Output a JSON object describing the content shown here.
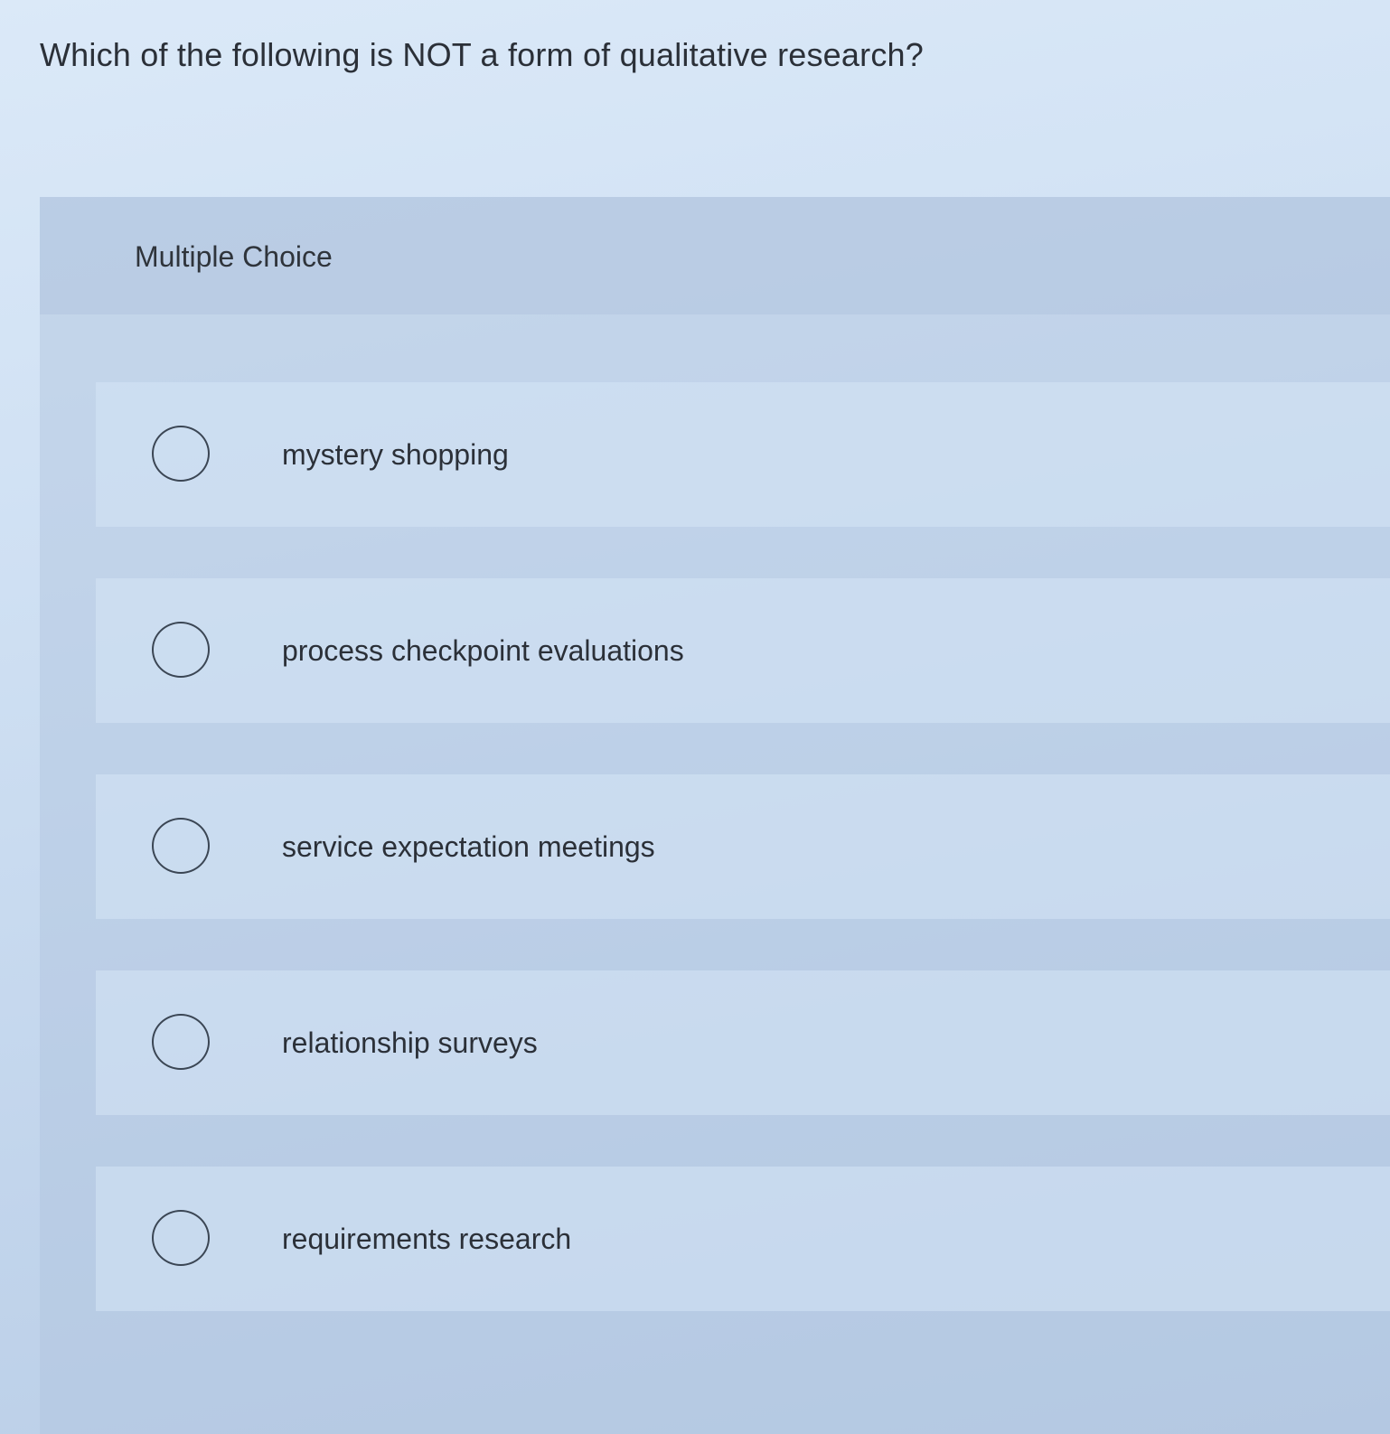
{
  "question": {
    "text": "Which of the following is NOT a form of qualitative research?"
  },
  "panel": {
    "title": "Multiple Choice"
  },
  "options": [
    {
      "label": "mystery shopping",
      "selected": false
    },
    {
      "label": "process checkpoint evaluations",
      "selected": false
    },
    {
      "label": "service expectation meetings",
      "selected": false
    },
    {
      "label": "relationship surveys",
      "selected": false
    },
    {
      "label": "requirements research",
      "selected": false
    }
  ],
  "colors": {
    "background": "#cfe0f3",
    "text": "#2b3038",
    "radio_border": "#3b4654"
  }
}
